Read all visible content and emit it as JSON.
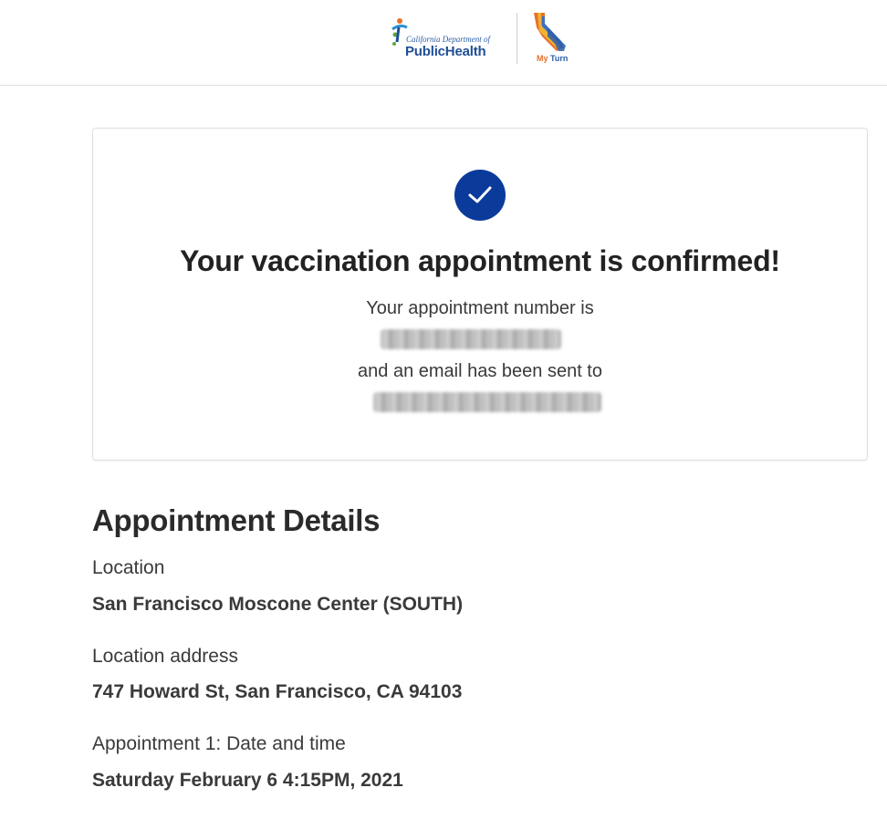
{
  "header": {
    "cdph_logo_small_text": "California Department of",
    "cdph_logo_big_text": "PublicHealth",
    "myturn_logo_my": "My",
    "myturn_logo_turn": "Turn",
    "colors": {
      "cdph_blue": "#1f4e96",
      "myturn_orange": "#e8702a"
    }
  },
  "confirmation": {
    "icon": "check-icon",
    "title": "Your vaccination appointment is confirmed!",
    "line1": "Your appointment number is",
    "line2": "and an email has been sent to",
    "accent_color": "#0a3a9a"
  },
  "details": {
    "title": "Appointment Details",
    "location_label": "Location",
    "location_value": "San Francisco Moscone Center (SOUTH)",
    "address_label": "Location address",
    "address_value": "747 Howard St, San Francisco, CA 94103",
    "datetime_label": "Appointment 1: Date and time",
    "datetime_value": "Saturday February 6 4:15PM, 2021"
  }
}
